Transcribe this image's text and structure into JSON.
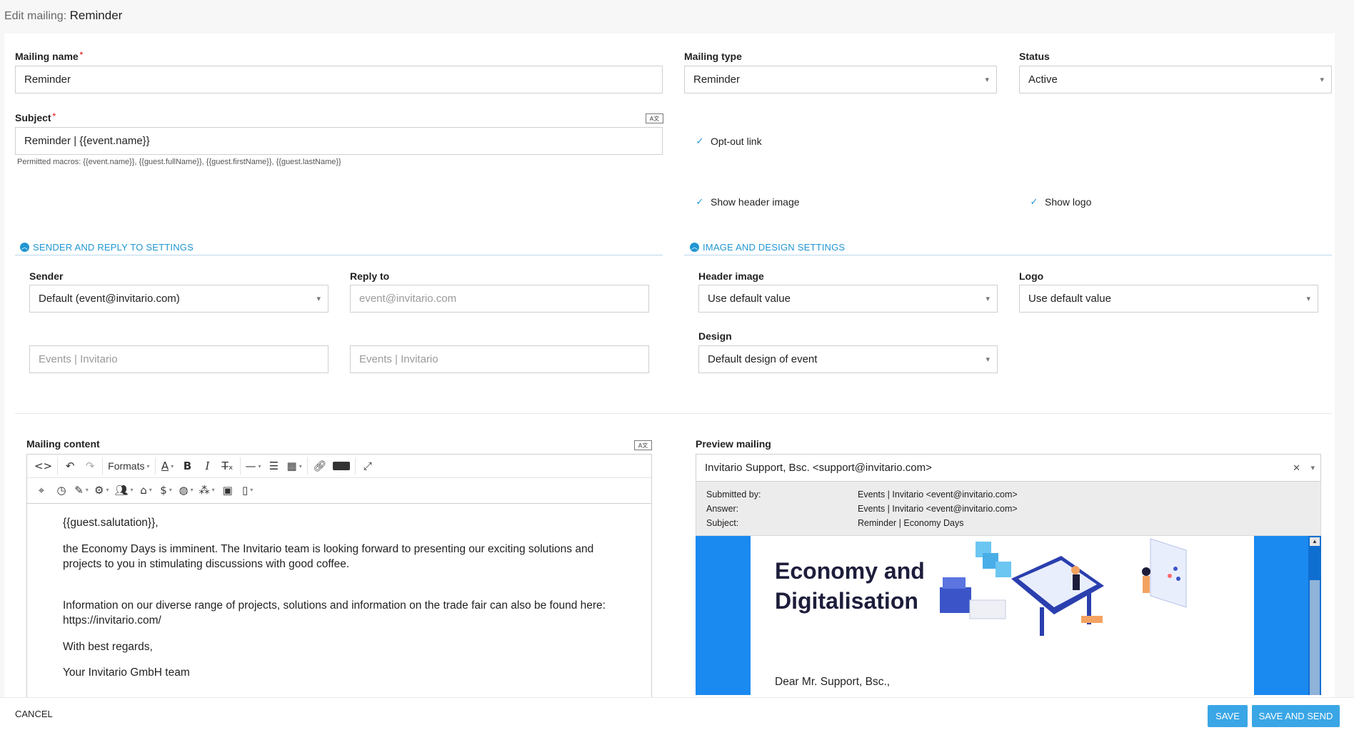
{
  "header": {
    "prefix": "Edit mailing:",
    "name": "Reminder"
  },
  "form": {
    "mailing_name_label": "Mailing name",
    "mailing_name_value": "Reminder",
    "mailing_type_label": "Mailing type",
    "mailing_type_value": "Reminder",
    "status_label": "Status",
    "status_value": "Active",
    "subject_label": "Subject",
    "subject_value": "Reminder | {{event.name}}",
    "permitted_macros": "Permitted macros: {{event.name}}, {{guest.fullName}}, {{guest.firstName}}, {{guest.lastName}}",
    "optout_label": "Opt-out link",
    "show_header_image_label": "Show header image",
    "show_logo_label": "Show logo",
    "lang_icon_text": "A文"
  },
  "sender_section": {
    "title": "SENDER AND REPLY TO SETTINGS",
    "sender_label": "Sender",
    "sender_value": "Default (event@invitario.com)",
    "reply_to_label": "Reply to",
    "reply_to_placeholder": "event@invitario.com",
    "sender_name_placeholder": "Events | Invitario",
    "reply_name_placeholder": "Events | Invitario"
  },
  "design_section": {
    "title": "IMAGE AND DESIGN SETTINGS",
    "header_image_label": "Header image",
    "header_image_value": "Use default value",
    "logo_label": "Logo",
    "logo_value": "Use default value",
    "design_label": "Design",
    "design_value": "Default design of event"
  },
  "editor": {
    "label": "Mailing content",
    "formats_label": "Formats",
    "content": {
      "p1": "{{guest.salutation}},",
      "p2": "the Economy Days  is imminent. The Invitario team is looking forward to presenting our exciting solutions and projects to you in stimulating discussions with good coffee.",
      "p3": "Information on our diverse range of projects, solutions and information on the trade fair can also be found here: https://invitario.com/",
      "p4": "With best regards,",
      "p5": "Your Invitario GmbH team"
    }
  },
  "preview": {
    "label": "Preview mailing",
    "recipient": "Invitario Support, Bsc. <support@invitario.com>",
    "submitted_by_key": "Submitted by:",
    "submitted_by_val": "Events | Invitario <event@invitario.com>",
    "answer_key": "Answer:",
    "answer_val": "Events | Invitario <event@invitario.com>",
    "subject_key": "Subject:",
    "subject_val": "Reminder | Economy Days",
    "banner_title_1": "Economy and",
    "banner_title_2": "Digitalisation",
    "greeting": "Dear Mr. Support, Bsc.,"
  },
  "footer": {
    "cancel": "CANCEL",
    "save": "SAVE",
    "save_and_send": "SAVE AND SEND"
  },
  "colors": {
    "accent": "#2196d3",
    "button": "#3aa6e6",
    "mail_frame": "#1a8af0"
  }
}
